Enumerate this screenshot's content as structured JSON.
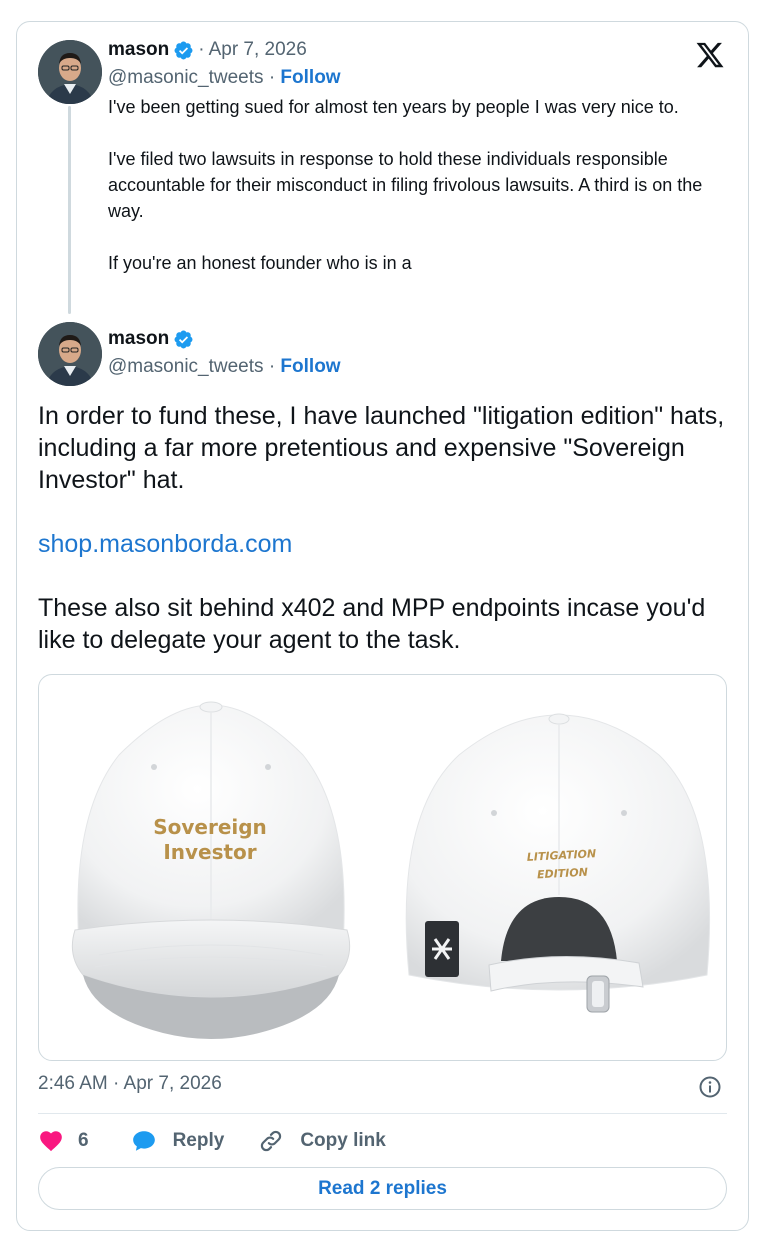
{
  "quoted_tweet": {
    "author_name": "mason",
    "handle": "@masonic_tweets",
    "separator": "·",
    "date": "Apr 7, 2026",
    "follow_label": "Follow",
    "paragraphs": [
      "I've been getting sued for almost ten years by people I was very nice to.",
      "I've filed two lawsuits in response to hold these individuals responsible accountable for their misconduct in filing frivolous lawsuits. A third is on the way.",
      "If you're an honest founder who is in a"
    ]
  },
  "main_tweet": {
    "author_name": "mason",
    "handle": "@masonic_tweets",
    "separator": "·",
    "follow_label": "Follow",
    "paragraph_1": "In order to fund these, I have launched \"litigation edition\" hats, including a far more pretentious and expensive \"Sovereign Investor\" hat.",
    "link": "shop.masonborda.com",
    "paragraph_2": "These also sit behind x402 and MPP endpoints incase you'd like to delegate your agent to the task.",
    "media": {
      "hat_front_text_line1": "Sovereign",
      "hat_front_text_line2": "Investor",
      "hat_back_text_line1": "LITIGATION",
      "hat_back_text_line2": "EDITION"
    },
    "timestamp": "2:46 AM · Apr 7, 2026",
    "like_count": "6",
    "reply_label": "Reply",
    "copy_link_label": "Copy link",
    "read_replies_label": "Read 2 replies"
  },
  "icons": {
    "logo": "x-logo-icon",
    "verified": "verified-badge-icon",
    "info": "info-icon",
    "like": "heart-icon",
    "reply": "reply-bubble-icon",
    "copy": "link-icon"
  },
  "colors": {
    "link_blue": "#1d76cf",
    "verified_blue": "#1d9bf0",
    "like_red": "#f91880",
    "muted_text": "#536471",
    "border": "#cfd9de",
    "hat_text_gold": "#b8914a"
  }
}
